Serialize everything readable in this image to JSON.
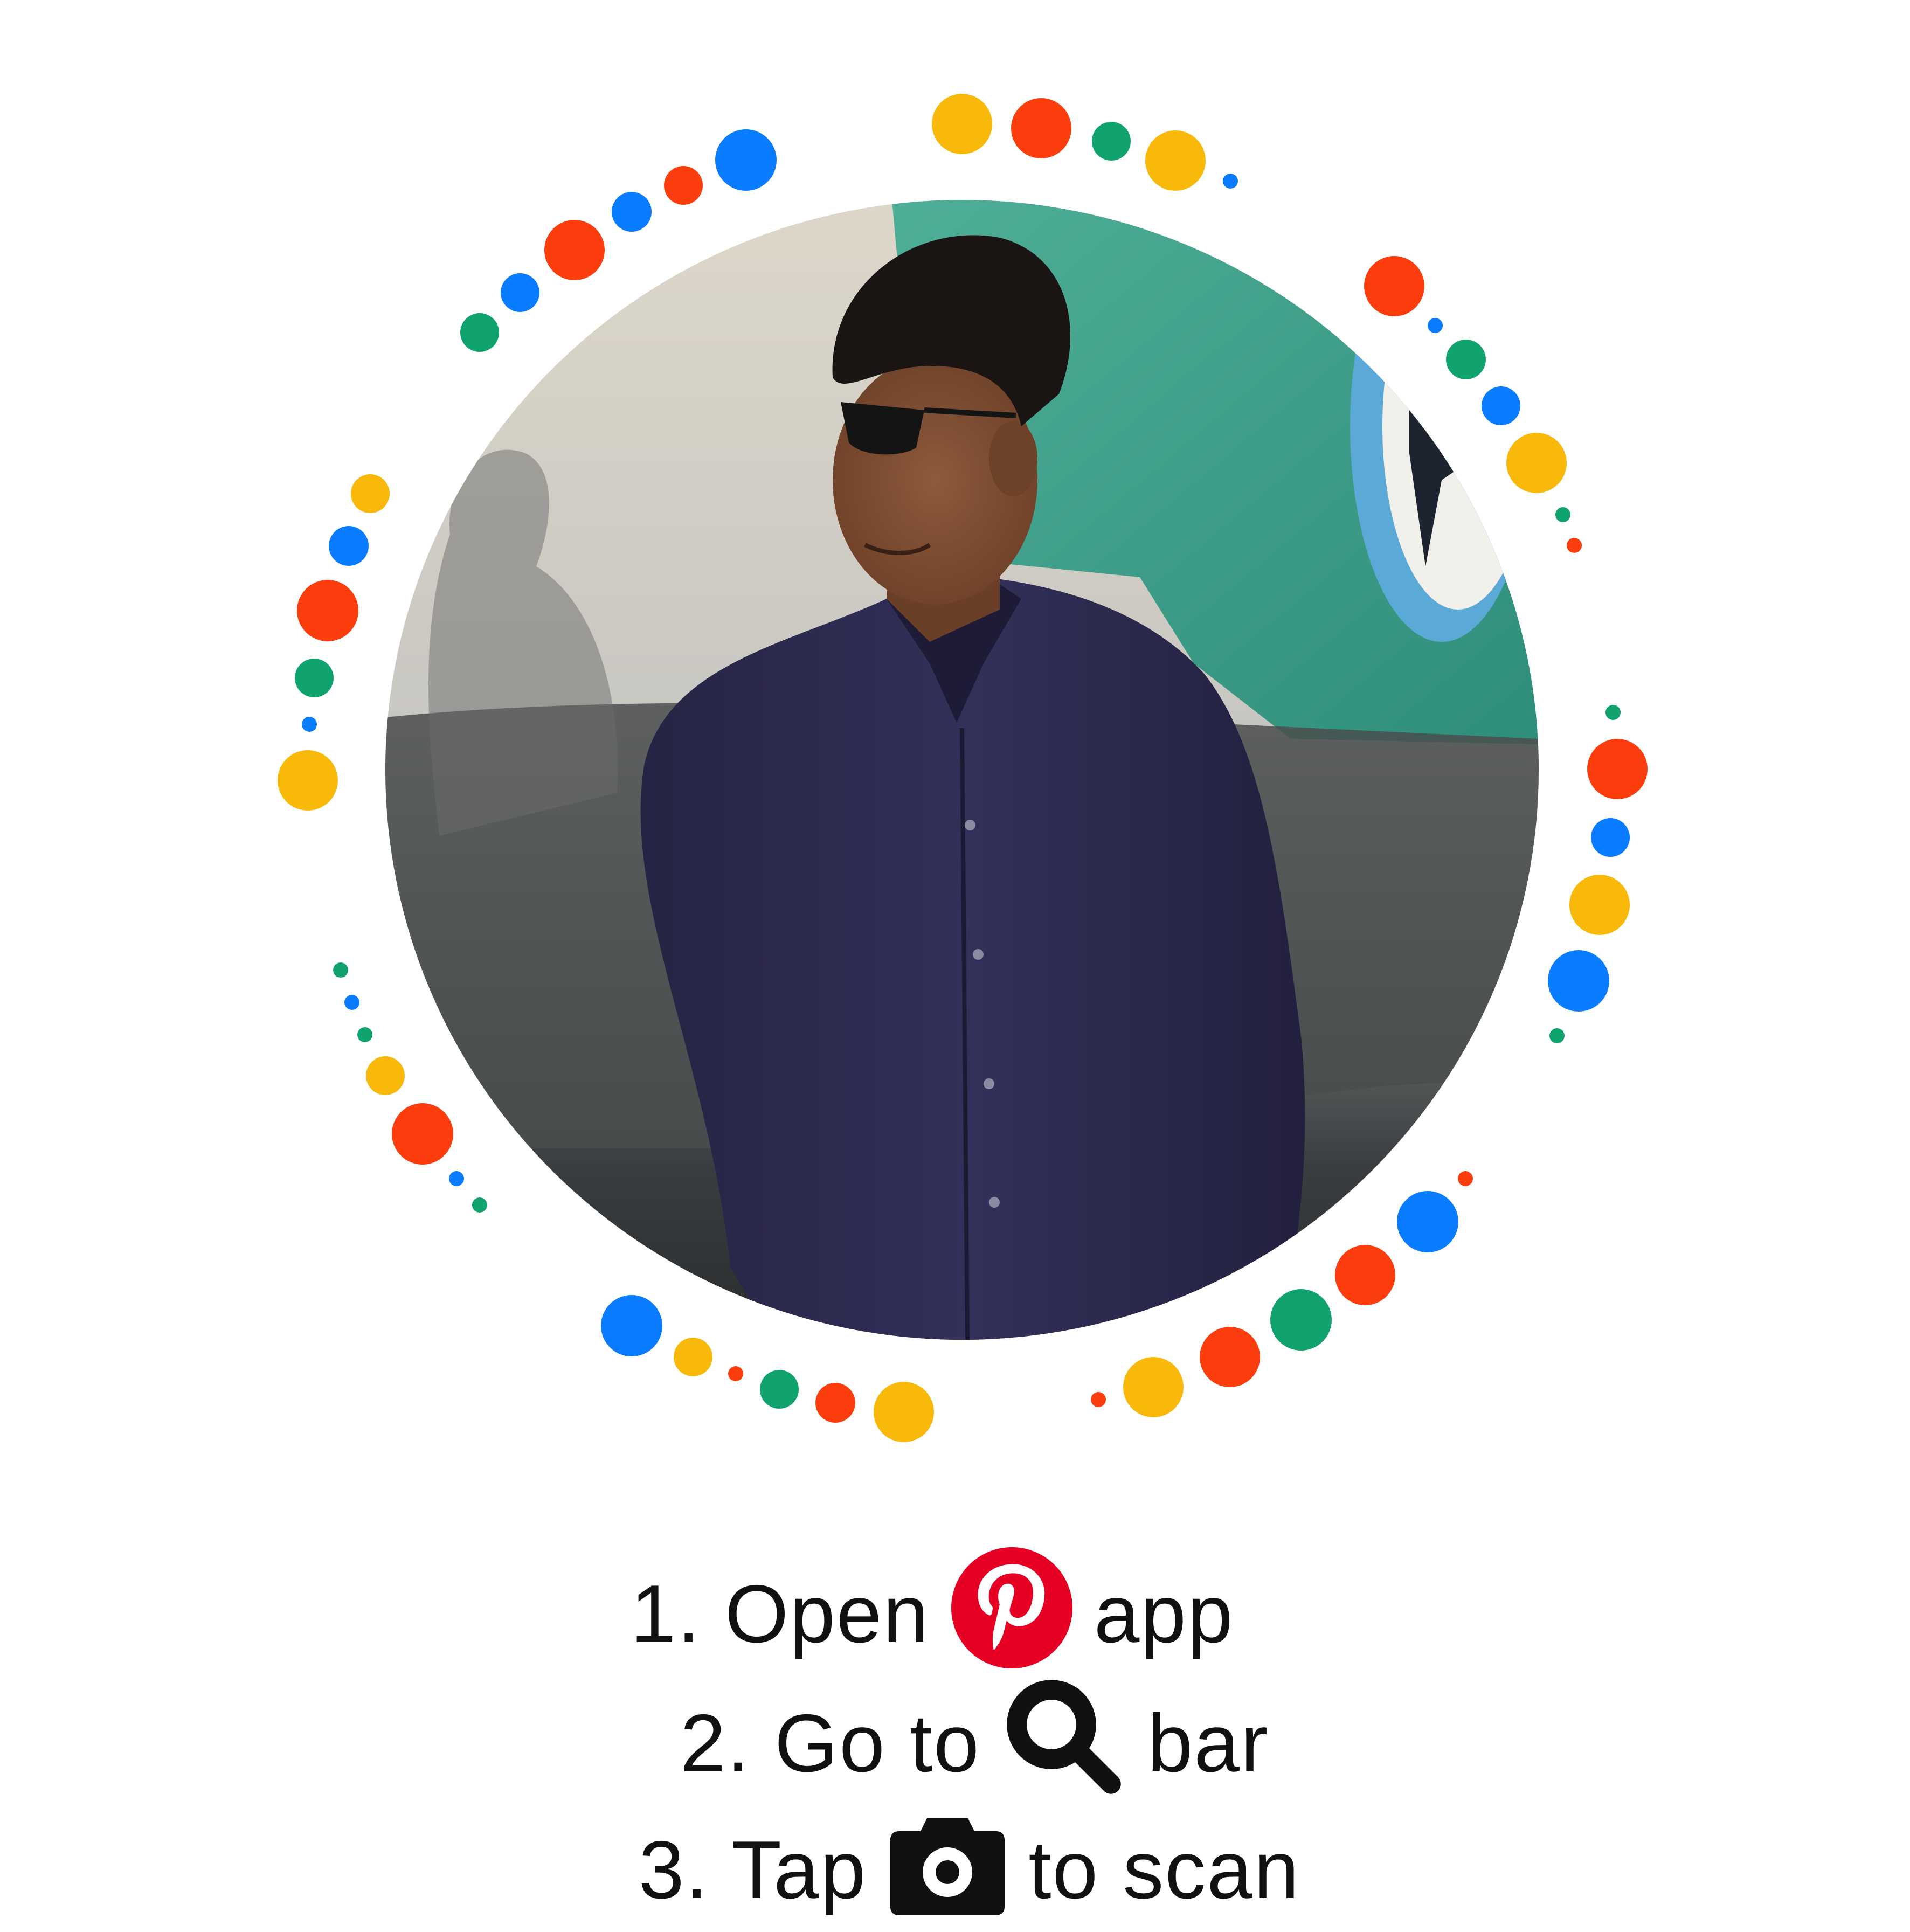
{
  "dots": {
    "colors": {
      "yellow": "#F8B90A",
      "red": "#FC3D0E",
      "green": "#10A36D",
      "blue": "#0A7CFF"
    }
  },
  "photo": {
    "subject": "man in navy button-up shirt and dark sunglasses leaning against a teal and grey aircraft"
  },
  "instructions": {
    "step1": {
      "prefix": "1. Open",
      "suffix": "app",
      "icon": "pinterest-logo-icon"
    },
    "step2": {
      "prefix": "2. Go to",
      "suffix": "bar",
      "icon": "search-icon"
    },
    "step3": {
      "prefix": "3. Tap",
      "suffix": "to scan",
      "icon": "camera-icon"
    }
  },
  "colors": {
    "pinterest_red": "#E60023",
    "text": "#111111",
    "background": "#FFFFFF"
  }
}
